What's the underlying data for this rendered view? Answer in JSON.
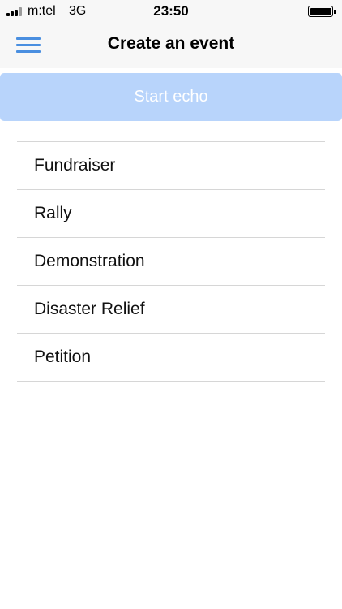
{
  "status_bar": {
    "carrier": "m:tel",
    "network": "3G",
    "time": "23:50",
    "battery_icon": "battery-full-icon",
    "signal_icon": "signal-bars-icon"
  },
  "nav": {
    "title": "Create an event",
    "menu_icon": "hamburger-menu-icon",
    "accent_color": "#4a8fe0"
  },
  "start_button": {
    "label": "Start echo",
    "state": "disabled",
    "color": "#b8d4fb"
  },
  "event_types": [
    {
      "label": "Fundraiser"
    },
    {
      "label": "Rally"
    },
    {
      "label": "Demonstration"
    },
    {
      "label": "Disaster Relief"
    },
    {
      "label": "Petition"
    }
  ]
}
